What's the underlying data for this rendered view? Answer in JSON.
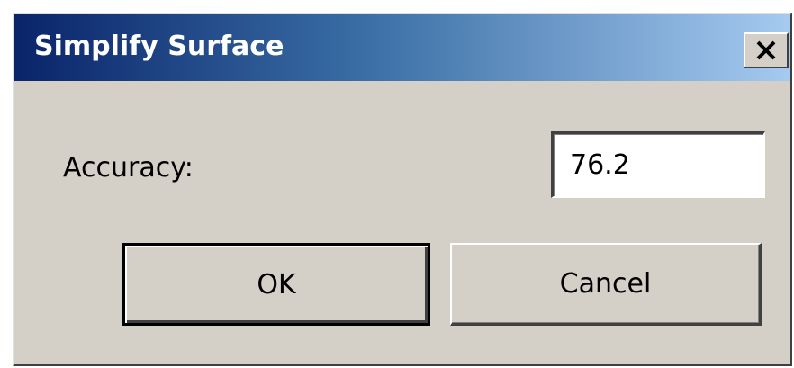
{
  "window": {
    "title": "Simplify Surface",
    "close_icon": "close-x-icon"
  },
  "form": {
    "accuracy_label": "Accuracy:",
    "accuracy_value": "76.2"
  },
  "buttons": {
    "ok_label": "OK",
    "cancel_label": "Cancel"
  },
  "colors": {
    "titlebar_start": "#0a246a",
    "titlebar_end": "#a6caf0",
    "dialog_background": "#d4d0c8"
  }
}
